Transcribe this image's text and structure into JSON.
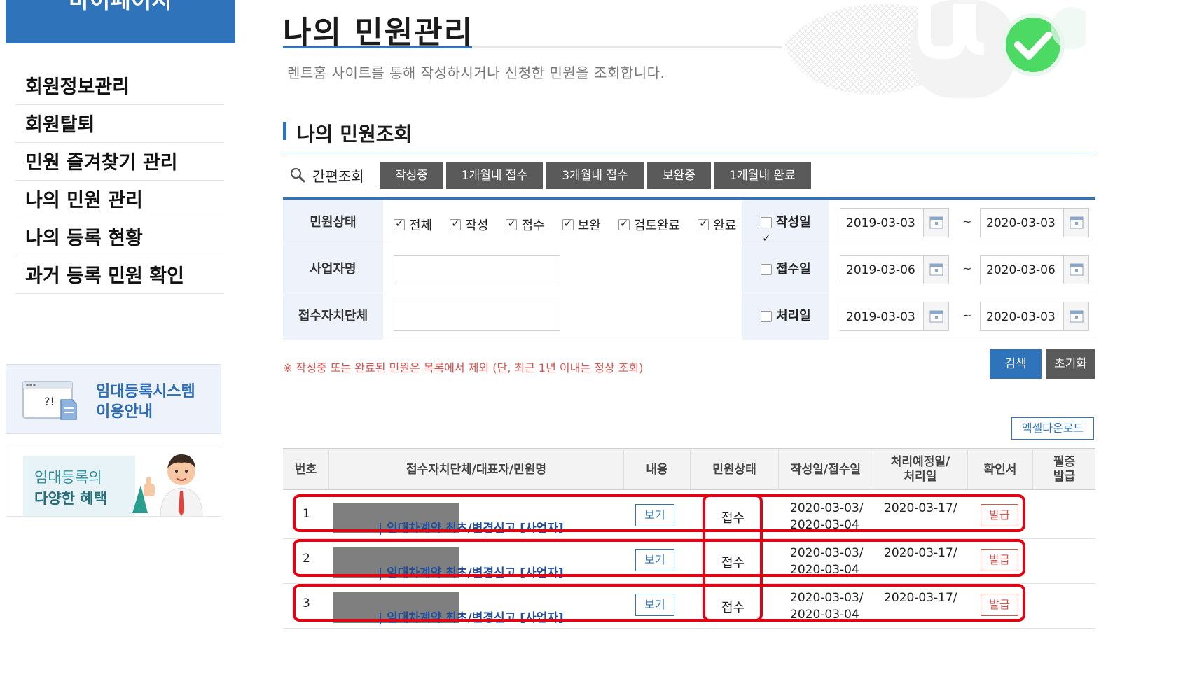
{
  "sidebar": {
    "banner": "마이페이지",
    "items": [
      "회원정보관리",
      "회원탈퇴",
      "민원 즐겨찾기 관리",
      "나의 민원 관리",
      "나의 등록 현황",
      "과거 등록 민원 확인"
    ],
    "promo1": {
      "line1": "임대등록시스템",
      "line2": "이용안내"
    },
    "promo2": {
      "line1": "임대등록의",
      "line2": "다양한 혜택"
    }
  },
  "header": {
    "title": "나의 민원관리",
    "subtitle": "렌트홈 사이트를 통해 작성하시거나 신청한 민원을 조회합니다."
  },
  "section": {
    "title": "나의 민원조회"
  },
  "quick": {
    "label": "간편조회",
    "buttons": [
      "작성중",
      "1개월내 접수",
      "3개월내 접수",
      "보완중",
      "1개월내 완료"
    ]
  },
  "filter": {
    "status_label": "민원상태",
    "status_options": [
      {
        "label": "전체",
        "checked": true
      },
      {
        "label": "작성",
        "checked": true
      },
      {
        "label": "접수",
        "checked": true
      },
      {
        "label": "보완",
        "checked": true
      },
      {
        "label": "검토완료",
        "checked": true
      },
      {
        "label": "완료",
        "checked": true
      }
    ],
    "business_label": "사업자명",
    "business_value": "",
    "agency_label": "접수자치단체",
    "agency_value": "",
    "date_rows": [
      {
        "label": "작성일",
        "checked": true,
        "from": "2019-03-03",
        "to": "2020-03-03"
      },
      {
        "label": "접수일",
        "checked": false,
        "from": "2019-03-06",
        "to": "2020-03-06"
      },
      {
        "label": "처리일",
        "checked": false,
        "from": "2019-03-03",
        "to": "2020-03-03"
      }
    ],
    "tilde": "~"
  },
  "notice": "※ 작성중 또는 완료된 민원은 목록에서 제외 (단, 최근 1년 이내는 정상 조회)",
  "actions": {
    "search": "검색",
    "reset": "초기화",
    "excel": "엑셀다운로드"
  },
  "table": {
    "headers": [
      "번호",
      "접수자치단체/대표자/민원명",
      "내용",
      "민원상태",
      "작성일/접수일",
      "처리예정일/\n처리일",
      "확인서",
      "필증\n발급"
    ],
    "rows": [
      {
        "no": "1",
        "name": "| 임대차계약 최초/변경신고 [사업자]",
        "view": "보기",
        "status": "접수",
        "written": "2020-03-03/",
        "received": "2020-03-04",
        "planned": "2020-03-17/",
        "issue": "발급"
      },
      {
        "no": "2",
        "name": "| 임대차계약 최초/변경신고 [사업자]",
        "view": "보기",
        "status": "접수",
        "written": "2020-03-03/",
        "received": "2020-03-04",
        "planned": "2020-03-17/",
        "issue": "발급"
      },
      {
        "no": "3",
        "name": "| 임대차계약 최초/변경신고 [사업자]",
        "view": "보기",
        "status": "접수",
        "written": "2020-03-03/",
        "received": "2020-03-04",
        "planned": "2020-03-17/",
        "issue": "발급"
      }
    ]
  },
  "colors": {
    "primary": "#2f73bb",
    "dark_button": "#5a5a5a",
    "annotation": "#e50012",
    "green_check": "#4cd964"
  }
}
